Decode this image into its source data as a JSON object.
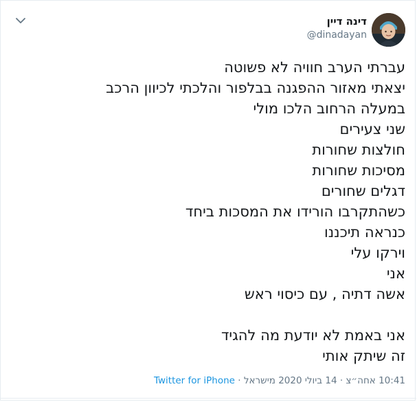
{
  "tweet": {
    "display_name": "דינה דיין",
    "handle": "@dinadayan",
    "lines": [
      "עברתי הערב חוויה לא פשוטה",
      "יצאתי מאזור ההפגנה בבלפור והלכתי לכיוון הרכב",
      "במעלה הרחוב הלכו מולי",
      "שני צעירים",
      "חולצות שחורות",
      "מסיכות שחורות",
      "דגלים שחורים",
      "כשהתקרבו הורידו את המסכות ביחד",
      "כנראה תיכננו",
      "וירקו עלי",
      "אני",
      "אשה דתיה , עם כיסוי ראש",
      "",
      "אני באמת לא יודעת מה להגיד",
      "זה שיתק אותי"
    ],
    "timestamp": "10:41 אחה״צ · 14 ביולי 2020 מישראל",
    "separator": "·",
    "source": "Twitter for iPhone"
  },
  "icons": {
    "menu": "chevron-down-icon",
    "avatar": "profile-photo"
  },
  "colors": {
    "text": "#14171a",
    "secondary": "#657786",
    "link": "#1b95e0",
    "border": "#e6ecf0"
  }
}
